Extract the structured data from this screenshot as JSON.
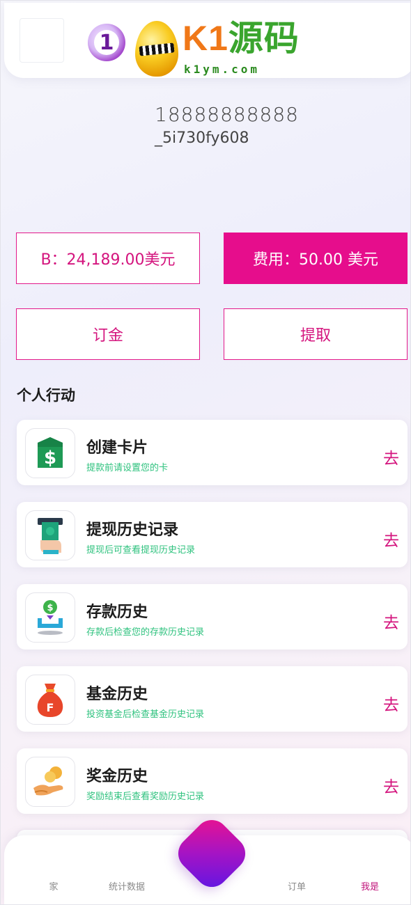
{
  "header": {
    "logo_badge": "1",
    "logo_brand_prefix": "K1",
    "logo_brand_suffix": "源码",
    "logo_domain": "k1ym.com"
  },
  "user": {
    "phone": "18888888888",
    "id": "_5i730fy608"
  },
  "stats": {
    "balance": "B：24,189.00美元",
    "fee": "费用：50.00 美元"
  },
  "actions": {
    "deposit": "订金",
    "withdraw": "提取"
  },
  "section_title": "个人行动",
  "cards": [
    {
      "title": "创建卡片",
      "desc": "提款前请设置您的卡",
      "go": "去",
      "icon": "dollar-card-icon"
    },
    {
      "title": "提现历史记录",
      "desc": "提现后可查看提现历史记录",
      "go": "去",
      "icon": "atm-withdraw-icon"
    },
    {
      "title": "存款历史",
      "desc": "存款后检查您的存款历史记录",
      "go": "去",
      "icon": "deposit-coin-icon"
    },
    {
      "title": "基金历史",
      "desc": "投资基金后检查基金历史记录",
      "go": "去",
      "icon": "money-bag-icon"
    },
    {
      "title": "奖金历史",
      "desc": "奖励结束后查看奖励历史记录",
      "go": "去",
      "icon": "hand-coins-icon"
    }
  ],
  "nav": {
    "home": "家",
    "stats": "统计数据",
    "orders": "订单",
    "me": "我是"
  },
  "colors": {
    "accent": "#e60d8c",
    "desc_green": "#2ec27e"
  }
}
